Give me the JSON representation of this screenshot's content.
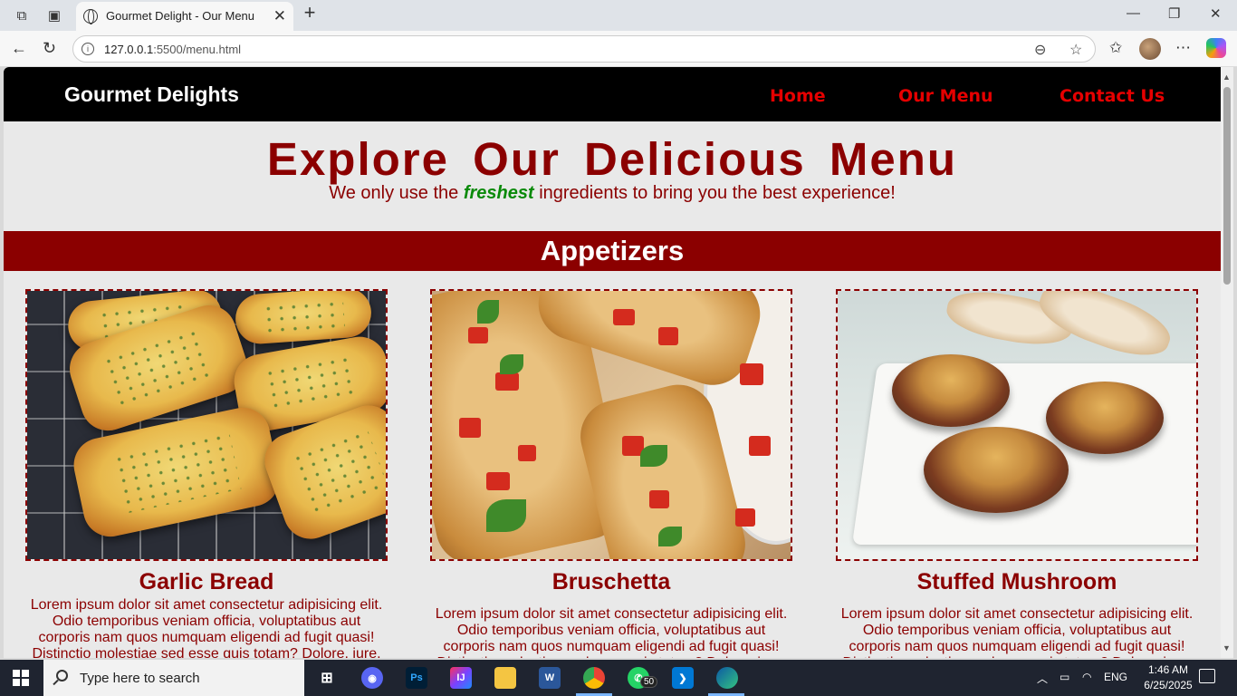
{
  "browser": {
    "tab_title": "Gourmet Delight - Our Menu",
    "url_host": "127.0.0.1",
    "url_path": ":5500/menu.html"
  },
  "site": {
    "brand": "Gourmet Delights",
    "nav": [
      {
        "label": "Home"
      },
      {
        "label": "Our Menu"
      },
      {
        "label": "Contact Us"
      }
    ]
  },
  "hero": {
    "title": "Explore Our Delicious Menu",
    "sub_before": "We only use the",
    "sub_emph": "freshest",
    "sub_after": "ingredients to bring you the best experience!"
  },
  "section": {
    "title": "Appetizers"
  },
  "items": [
    {
      "name": "Garlic Bread",
      "description": "Lorem ipsum dolor sit amet consectetur adipisicing elit. Odio temporibus veniam officia, voluptatibus aut corporis nam quos numquam eligendi ad fugit quasi! Distinctio molestiae sed esse quis totam? Dolore, iure."
    },
    {
      "name": "Bruschetta",
      "description": "Lorem ipsum dolor sit amet consectetur adipisicing elit. Odio temporibus veniam officia, voluptatibus aut corporis nam quos numquam eligendi ad fugit quasi! Distinctio molestiae sed esse quis totam? Dolore, iure."
    },
    {
      "name": "Stuffed Mushroom",
      "description": "Lorem ipsum dolor sit amet consectetur adipisicing elit. Odio temporibus veniam officia, voluptatibus aut corporis nam quos numquam eligendi ad fugit quasi! Distinctio molestiae sed esse quis totam? Dolore, iure."
    }
  ],
  "taskbar": {
    "search_placeholder": "Type here to search",
    "whatsapp_badge": "50",
    "language": "ENG",
    "time": "1:46 AM",
    "date": "6/25/2025"
  },
  "colors": {
    "brand_red": "#8b0000",
    "nav_red": "#e60000",
    "fresh_green": "#0a8a0a"
  }
}
